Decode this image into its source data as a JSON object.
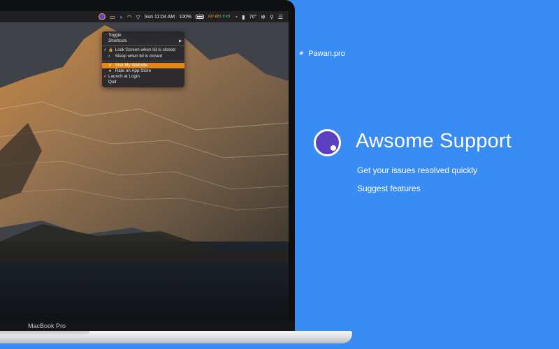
{
  "menubar": {
    "time": "Sun 11:04 AM",
    "battery": "100%",
    "net_up": "627 KB",
    "net_down": "1.8 KB",
    "temperature": "70°"
  },
  "menu": {
    "items": [
      {
        "label": "Toggle",
        "checked": false,
        "icon": "",
        "submenu": false,
        "selected": false
      },
      {
        "label": "Shortcuts",
        "checked": false,
        "icon": "",
        "submenu": true,
        "selected": false
      },
      {
        "label": "Lock Screen when lid is closed",
        "checked": true,
        "icon": "lock-icon",
        "submenu": false,
        "selected": false
      },
      {
        "label": "Sleep when lid is closed",
        "checked": false,
        "icon": "sleep-icon",
        "submenu": false,
        "selected": false
      },
      {
        "label": "Visit My Website",
        "checked": false,
        "icon": "trophy-icon",
        "submenu": false,
        "selected": true
      },
      {
        "label": "Rate on App Store",
        "checked": false,
        "icon": "star-icon",
        "submenu": false,
        "selected": false
      },
      {
        "label": "Launch at Login",
        "checked": true,
        "icon": "",
        "submenu": false,
        "selected": false
      },
      {
        "label": "Quit",
        "checked": false,
        "icon": "",
        "submenu": false,
        "selected": false
      }
    ]
  },
  "laptop": {
    "model_label": "MacBook Pro"
  },
  "promo": {
    "website": "Pawan.pro",
    "title": "Awsome Support",
    "features": [
      "Get your issues resolved quickly",
      "Suggest features"
    ]
  },
  "colors": {
    "background": "#3a8cf5",
    "logo_purple": "#5a3fbf",
    "menu_highlight": "#e0861c"
  }
}
